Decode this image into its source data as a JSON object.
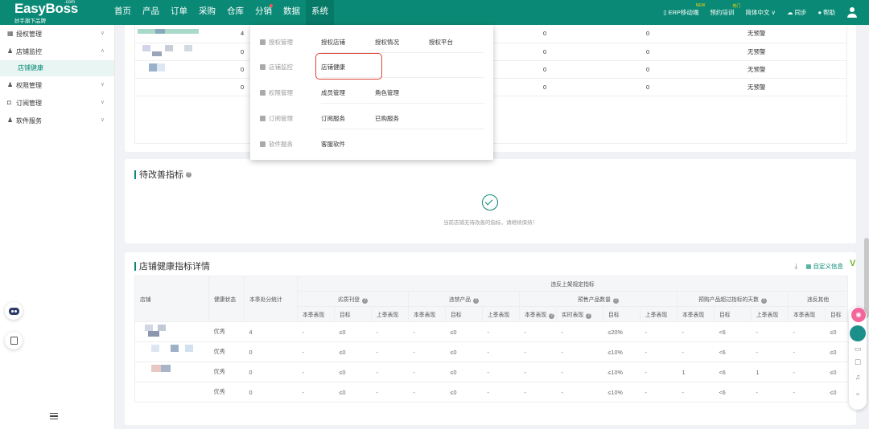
{
  "brand": {
    "name": "EasyBoss",
    "com": ".com",
    "slogan": "妙手旗下品牌"
  },
  "nav": [
    "首页",
    "产品",
    "订单",
    "采购",
    "仓库",
    "分销",
    "数据",
    "系统"
  ],
  "top_right": {
    "erp": "ERP移动端",
    "erp_badge": "NEW",
    "training": "预约培训",
    "training_badge": "热门",
    "lang": "简体中文 ∨",
    "sync": "同步",
    "help": "帮助"
  },
  "sidebar": {
    "items": [
      {
        "label": "授权管理",
        "chev": "∨"
      },
      {
        "label": "店铺监控",
        "chev": "∧"
      },
      {
        "label": "权限管理",
        "chev": "∨"
      },
      {
        "label": "订阅管理",
        "chev": "∨"
      },
      {
        "label": "软件服务",
        "chev": "∨"
      }
    ],
    "sub_active": "店铺健康"
  },
  "top_rows": [
    {
      "num": "4",
      "a": "0",
      "b": "0",
      "status": "无预警"
    },
    {
      "num": "0",
      "a": "0",
      "b": "0",
      "status": "无预警"
    },
    {
      "num": "0",
      "a": "0",
      "b": "0",
      "status": "无预警"
    },
    {
      "num": "0",
      "a": "0",
      "b": "0",
      "status": "无预警"
    }
  ],
  "improve": {
    "title": "待改善指标",
    "empty_text": "当前店铺无待改善的指标，请继续保持！"
  },
  "detail": {
    "title": "店铺健康指标详情",
    "custom_info": "自定义信息",
    "group_header": "违反上架规定指标",
    "headers": {
      "shop": "店铺",
      "status": "健康状态",
      "penalty": "本季处分统计"
    },
    "subgroups": [
      "劣质刊登",
      "违禁产品",
      "预售产品数量",
      "预购产品超过指标的天数",
      "违反其他"
    ],
    "cols": [
      "本季表现",
      "目标",
      "上季表现",
      "本季表现",
      "目标",
      "上季表现",
      "本季表现",
      "实时表现",
      "目标",
      "上季表现",
      "本季表现",
      "目标",
      "上季表现",
      "本季表现",
      "目标"
    ],
    "rows": [
      {
        "status": "优秀",
        "penalty": "4",
        "c": [
          "-",
          "≤0",
          "-",
          "-",
          "≤0",
          "-",
          "-",
          "-",
          "≤20%",
          "-",
          "-",
          "<6",
          "-",
          "-",
          "≤0"
        ]
      },
      {
        "status": "优秀",
        "penalty": "0",
        "c": [
          "-",
          "≤0",
          "-",
          "-",
          "≤0",
          "-",
          "-",
          "-",
          "≤10%",
          "-",
          "-",
          "<6",
          "-",
          "-",
          "≤0"
        ]
      },
      {
        "status": "优秀",
        "penalty": "0",
        "c": [
          "-",
          "≤0",
          "-",
          "-",
          "≤0",
          "-",
          "-",
          "-",
          "≤10%",
          "-",
          "1",
          "<6",
          "1",
          "-",
          "≤0"
        ]
      },
      {
        "status": "优秀",
        "penalty": "0",
        "c": [
          "-",
          "≤0",
          "-",
          "-",
          "≤0",
          "-",
          "-",
          "-",
          "≤10%",
          "-",
          "-",
          "<6",
          "-",
          "-",
          "≤0"
        ]
      }
    ]
  },
  "dropdown": [
    {
      "cat": "授权管理",
      "links": [
        "授权店铺",
        "授权情况",
        "授权平台"
      ]
    },
    {
      "cat": "店铺监控",
      "links": [
        "店铺健康"
      ]
    },
    {
      "cat": "权限管理",
      "links": [
        "成员管理",
        "角色管理"
      ]
    },
    {
      "cat": "订阅管理",
      "links": [
        "订阅服务",
        "已购服务"
      ]
    },
    {
      "cat": "软件服务",
      "links": [
        "客服软件"
      ]
    }
  ],
  "colors": {
    "primary": "#0a8a76",
    "highlight": "#e0443a"
  }
}
